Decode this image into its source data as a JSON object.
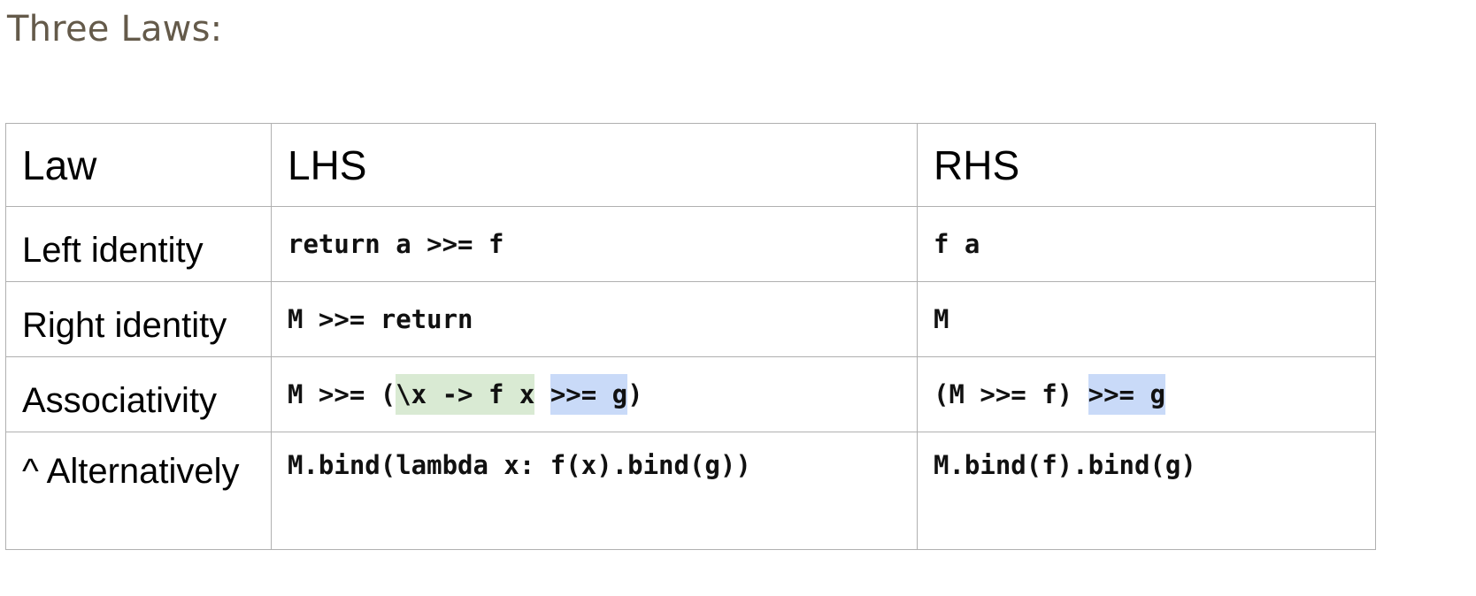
{
  "heading": "Three Laws:",
  "table": {
    "headers": [
      "Law",
      "LHS",
      "RHS"
    ],
    "rows": [
      {
        "law": "Left identity",
        "lhs": "return a >>= f",
        "rhs": "f a"
      },
      {
        "law": "Right identity",
        "lhs": "M >>= return",
        "rhs": "M"
      },
      {
        "law": "Associativity",
        "lhs_parts": {
          "prefix": "M >>= (",
          "green": "\\x -> f x",
          "space": " ",
          "blue": ">>= g",
          "suffix": ")"
        },
        "rhs_parts": {
          "prefix": "(M >>= f) ",
          "blue": ">>= g"
        }
      },
      {
        "law": "^ Alternatively",
        "lhs": "M.bind(lambda x: f(x).bind(g))",
        "rhs": "M.bind(f).bind(g)"
      }
    ]
  },
  "highlight_colors": {
    "green": "#d9ead3",
    "blue": "#c9daf8"
  }
}
